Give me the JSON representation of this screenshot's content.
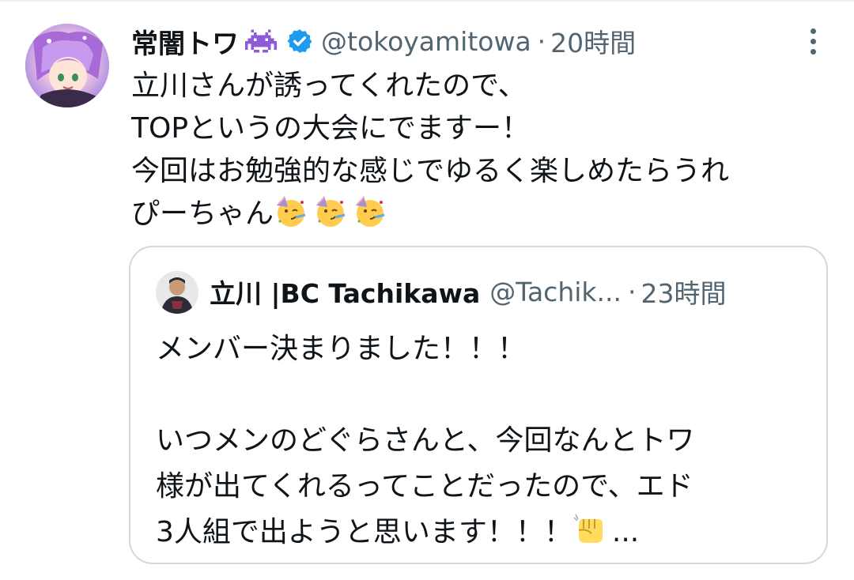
{
  "tweet": {
    "display_name": "常闇トワ",
    "name_emoji": "alien-monster-icon",
    "verified_icon": "verified-badge-icon",
    "handle": "@tokoyamitowa",
    "separator": "·",
    "time": "20時間",
    "more_icon": "more-vertical-icon",
    "text_lines": [
      "立川さんが誘ってくれたので、",
      "TOPというの大会にでますー！",
      "今回はお勉強的な感じでゆるく楽しめたらうれ",
      "ぴーちゃん"
    ],
    "text_trailing_emoji": [
      "partying-face-icon",
      "partying-face-icon",
      "partying-face-icon"
    ],
    "colors": {
      "text": "#0f1419",
      "secondary": "#536471",
      "verified": "#1d9bf0",
      "border": "#cfd9de"
    }
  },
  "quoted": {
    "display_name": "立川 |BC Tachikawa",
    "handle": "@Tachik...",
    "separator": "·",
    "time": "23時間",
    "text_lines": [
      "メンバー決まりました！！！",
      "",
      "いつメンのどぐらさんと、今回なんとトワ",
      "様が出てくれるってことだったので、エド",
      "3人組で出ようと思います！！！"
    ],
    "trailing_emoji": "oncoming-fist-icon",
    "ellipsis": "..."
  }
}
